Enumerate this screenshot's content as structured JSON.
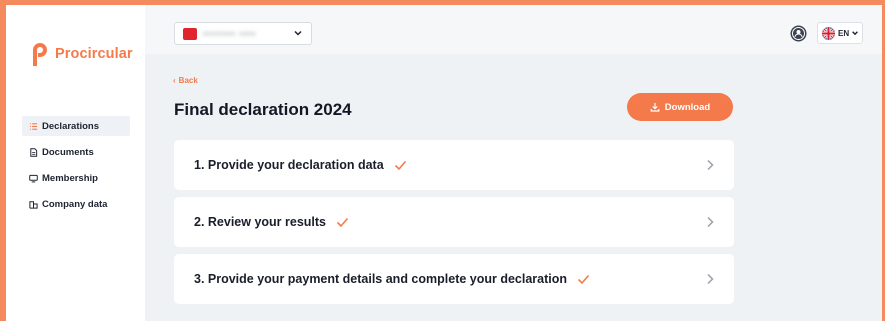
{
  "brand": {
    "name": "Procircular",
    "color": "#f47a4b"
  },
  "sidebar": {
    "items": [
      {
        "label": "Declarations",
        "icon": "list-icon",
        "active": true
      },
      {
        "label": "Documents",
        "icon": "document-icon",
        "active": false
      },
      {
        "label": "Membership",
        "icon": "membership-card-icon",
        "active": false
      },
      {
        "label": "Company data",
        "icon": "building-icon",
        "active": false
      }
    ]
  },
  "topbar": {
    "company_selector_value": "•••••••• ••••",
    "language": "EN"
  },
  "main": {
    "back_label": "Back",
    "title": "Final declaration 2024",
    "download_label": "Download",
    "steps": [
      {
        "label": "1. Provide your declaration data",
        "completed": true
      },
      {
        "label": "2. Review your results",
        "completed": true
      },
      {
        "label": "3. Provide your payment details and complete your declaration",
        "completed": true
      }
    ]
  }
}
